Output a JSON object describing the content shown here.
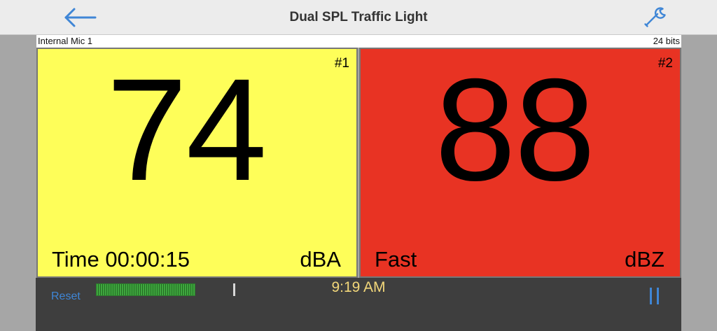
{
  "header": {
    "title": "Dual SPL Traffic Light"
  },
  "info": {
    "input_source": "Internal Mic 1",
    "bit_depth": "24 bits"
  },
  "meters": [
    {
      "index_label": "#1",
      "value": "74",
      "mode_label": "Time 00:00:15",
      "weighting": "dBA",
      "color": "#fefe59"
    },
    {
      "index_label": "#2",
      "value": "88",
      "mode_label": "Fast",
      "weighting": "dBZ",
      "color": "#e83323"
    }
  ],
  "toolbar": {
    "reset_label": "Reset",
    "clock": "9:19 AM",
    "level_color": "#3ea63e",
    "accent_color": "#3f86d6"
  },
  "icons": {
    "back": "arrow-left-icon",
    "settings": "wrench-icon",
    "pause": "pause-icon"
  }
}
